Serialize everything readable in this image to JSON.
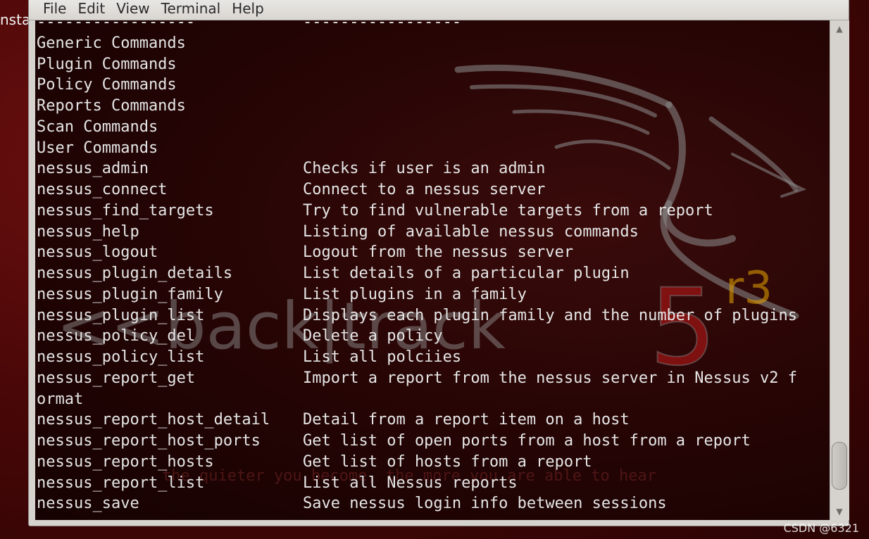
{
  "desktop": {
    "left_label": "nsta"
  },
  "window": {
    "menu": [
      "File",
      "Edit",
      "View",
      "Terminal",
      "Help"
    ]
  },
  "terminal": {
    "wallpaper": {
      "logo_text": "<<back|track",
      "version_digit": "5",
      "version_sup": "r3",
      "faint_text": "the quieter you become, the more you are able to hear"
    },
    "lines": [
      {
        "cmd": "-----------------",
        "desc": "-----------------"
      },
      {
        "cmd": "Generic Commands",
        "desc": ""
      },
      {
        "cmd": "Plugin Commands",
        "desc": ""
      },
      {
        "cmd": "Policy Commands",
        "desc": ""
      },
      {
        "cmd": "Reports Commands",
        "desc": ""
      },
      {
        "cmd": "Scan Commands",
        "desc": ""
      },
      {
        "cmd": "User Commands",
        "desc": ""
      },
      {
        "cmd": "nessus_admin",
        "desc": "Checks if user is an admin"
      },
      {
        "cmd": "nessus_connect",
        "desc": "Connect to a nessus server"
      },
      {
        "cmd": "nessus_find_targets",
        "desc": "Try to find vulnerable targets from a report"
      },
      {
        "cmd": "nessus_help",
        "desc": "Listing of available nessus commands"
      },
      {
        "cmd": "nessus_logout",
        "desc": "Logout from the nessus server"
      },
      {
        "cmd": "nessus_plugin_details",
        "desc": "List details of a particular plugin"
      },
      {
        "cmd": "nessus_plugin_family",
        "desc": "List plugins in a family"
      },
      {
        "cmd": "nessus_plugin_list",
        "desc": "Displays each plugin family and the number of plugins"
      },
      {
        "cmd": "nessus_policy_del",
        "desc": "Delete a policy"
      },
      {
        "cmd": "nessus_policy_list",
        "desc": "List all polciies"
      },
      {
        "cmd": "nessus_report_get",
        "desc": "Import a report from the nessus server in Nessus v2 f"
      },
      {
        "cmd": "ormat",
        "desc": ""
      },
      {
        "cmd": "nessus_report_host_detail",
        "desc": "Detail from a report item on a host"
      },
      {
        "cmd": "nessus_report_host_ports",
        "desc": "Get list of open ports from a host from a report"
      },
      {
        "cmd": "nessus_report_hosts",
        "desc": "Get list of hosts from a report"
      },
      {
        "cmd": "nessus_report_list",
        "desc": "List all Nessus reports"
      },
      {
        "cmd": "nessus_save",
        "desc": "Save nessus login info between sessions"
      }
    ]
  },
  "scrollbar": {
    "up_icon": "arrow-up-icon",
    "down_icon": "arrow-down-icon",
    "position_fraction": 0.9
  },
  "watermark": "CSDN @6321",
  "colors": {
    "terminal_text": "#e6e6e6",
    "menu_bg": "#d6d3ce",
    "logo_red": "#c21a1a",
    "logo_orange": "#d99a00"
  }
}
